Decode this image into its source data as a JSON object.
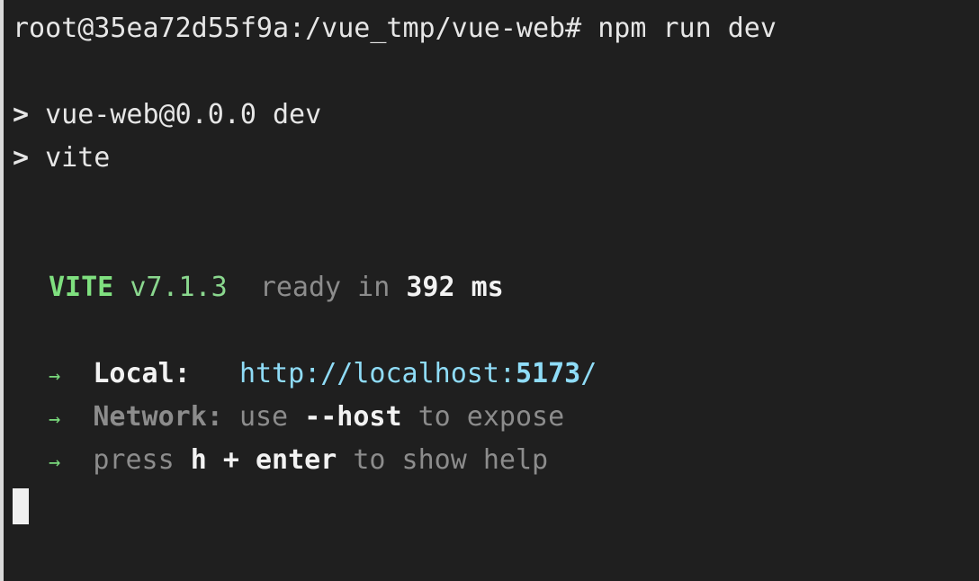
{
  "terminal": {
    "prompt": "root@35ea72d55f9a:/vue_tmp/vue-web#",
    "command": "npm run dev",
    "script_lines": [
      {
        "marker": ">",
        "text": "vue-web@0.0.0 dev"
      },
      {
        "marker": ">",
        "text": "vite"
      }
    ],
    "vite_banner": {
      "name": "VITE",
      "version": "v7.1.3",
      "ready_text": "ready in",
      "time": "392",
      "unit": "ms"
    },
    "info_lines": {
      "arrow": "→",
      "local_label": "Local:",
      "local_url_prefix": "http://localhost:",
      "local_port": "5173",
      "local_url_suffix": "/",
      "network_label": "Network:",
      "network_use": "use",
      "network_flag": "--host",
      "network_rest": "to expose",
      "press": "press",
      "help_key": "h + enter",
      "help_rest": "to show help"
    }
  },
  "colors": {
    "background": "#1f1f1f",
    "text": "#e6e6e6",
    "green": "#8ad78e",
    "dim": "#8c8c8c",
    "cyan": "#8fdcf7"
  }
}
